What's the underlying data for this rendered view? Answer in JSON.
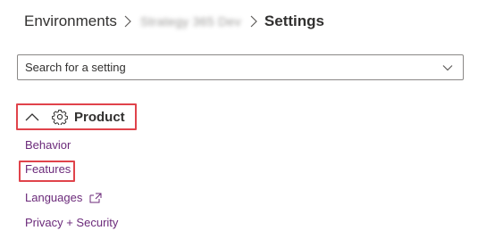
{
  "breadcrumb": {
    "root": "Environments",
    "environment": "Strategy 365 Dev",
    "current": "Settings"
  },
  "search": {
    "placeholder": "Search for a setting",
    "value": ""
  },
  "section": {
    "title": "Product",
    "icon": "gear-icon",
    "expanded": true
  },
  "nav": {
    "behavior": "Behavior",
    "features": "Features",
    "languages": "Languages",
    "privacy": "Privacy + Security"
  },
  "colors": {
    "highlight": "#e0434b",
    "link": "#6b2a7a",
    "text": "#323130",
    "border": "#8a8886"
  }
}
